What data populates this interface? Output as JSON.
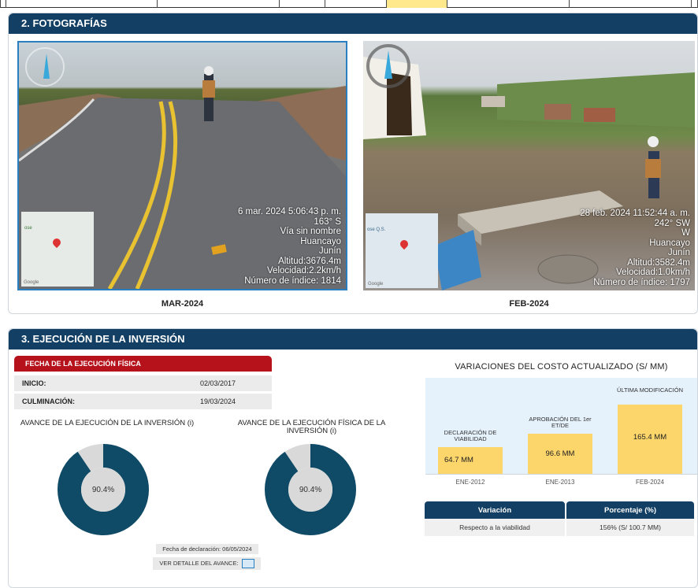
{
  "photos_section": {
    "title": "2. FOTOGRAFÍAS",
    "photos": [
      {
        "caption": "MAR-2024",
        "overlay_lines": [
          "6 mar. 2024 5:06:43 p. m.",
          "163° S",
          "Vía sin nombre",
          "Huancayo",
          "Junín",
          "Altitud:3676.4m",
          "Velocidad:2.2km/h",
          "Número de índice: 1814"
        ],
        "map_label": "Google",
        "map_place": "ose"
      },
      {
        "caption": "FEB-2024",
        "overlay_lines": [
          "28 feb. 2024 11:52:44 a. m.",
          "242° SW",
          "W",
          "Huancayo",
          "Junín",
          "Altitud:3582.4m",
          "Velocidad:1.0km/h",
          "Número de índice: 1797"
        ],
        "map_label": "Google",
        "map_place": "ose Q.S."
      }
    ]
  },
  "investment_section": {
    "title": "3. EJECUCIÓN DE LA INVERSIÓN",
    "physical_execution": {
      "header": "FECHA DE LA EJECUCIÓN FÍSICA",
      "start_label": "INICIO:",
      "start_value": "02/03/2017",
      "end_label": "CULMINACIÓN:",
      "end_value": "19/03/2024"
    },
    "progress": [
      {
        "title": "AVANCE DE LA EJECUCIÓN DE LA INVERSIÓN (i)",
        "value": 90.4,
        "label": "90.4%"
      },
      {
        "title": "AVANCE DE LA EJECUCIÓN FÍSICA DE LA INVERSIÓN (i)",
        "value": 90.4,
        "label": "90.4%"
      }
    ],
    "declaration_date": "Fecha de declaración: 06/05/2024",
    "detail_button": "VER DETALLE DEL AVANCE:",
    "cost_variations": {
      "title": "VARIACIONES DEL COSTO ACTUALIZADO (S/ MM)",
      "bars": [
        {
          "top_label": "DECLARACIÓN DE VIABILIDAD",
          "value_label": "64.7 MM",
          "date": "ENE-2012",
          "value": 64.7
        },
        {
          "top_label": "APROBACIÓN DEL 1er ET/DE",
          "value_label": "96.6 MM",
          "date": "ENE-2013",
          "value": 96.6
        },
        {
          "top_label": "ÚLTIMA MODIFICACIÓN",
          "value_label": "165.4 MM",
          "date": "FEB-2024",
          "value": 165.4
        }
      ],
      "table_headers": [
        "Variación",
        "Porcentaje (%)"
      ],
      "table_row": [
        "Respecto a la viabilidad",
        "156% (S/ 100.7 MM)"
      ]
    }
  },
  "colors": {
    "primary": "#123f63",
    "accent_red": "#b5121b",
    "bar_yellow": "#fcd66b",
    "donut": "#0f4a66"
  }
}
